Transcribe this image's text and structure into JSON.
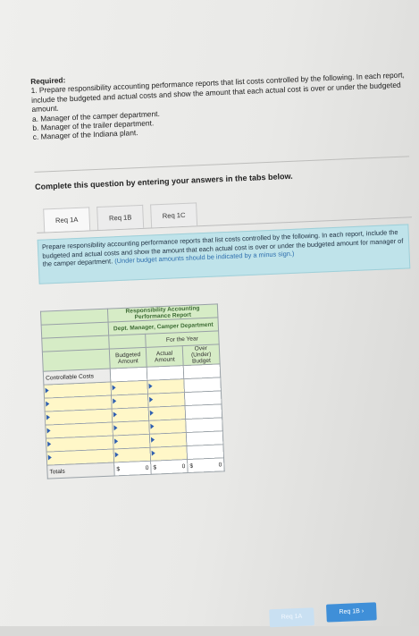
{
  "requirements": {
    "title": "Required:",
    "line1": "1. Prepare responsibility accounting performance reports that list costs controlled by the following. In each report, include the budgeted and actual costs and show the amount that each actual cost is over or under the budgeted amount.",
    "item_a": "a. Manager of the camper department.",
    "item_b": "b. Manager of the trailer department.",
    "item_c": "c. Manager of the Indiana plant."
  },
  "complete_prompt": "Complete this question by entering your answers in the tabs below.",
  "tabs": [
    {
      "label": "Req 1A",
      "active": true
    },
    {
      "label": "Req 1B",
      "active": false
    },
    {
      "label": "Req 1C",
      "active": false
    }
  ],
  "instructions": {
    "main": "Prepare responsibility accounting performance reports that list costs controlled by the following. In each report, include the budgeted and actual costs and show the amount that each actual cost is over or under the budgeted amount for manager of the camper department.",
    "note": "(Under budget amounts should be indicated by a minus sign.)"
  },
  "report": {
    "title": "Responsibility Accounting Performance Report",
    "subtitle": "Dept. Manager, Camper Department",
    "period": "For the Year",
    "col_budget": "Budgeted Amount",
    "col_actual": "Actual Amount",
    "col_over": "Over (Under) Budget",
    "row_controllable": "Controllable Costs",
    "row_totals": "Totals",
    "totals": {
      "budget": "0",
      "actual": "0",
      "over": "0",
      "currency": "$"
    }
  },
  "nav": {
    "prev": "Req 1A",
    "next": "Req 1B",
    "next_glyph": "›"
  },
  "colors": {
    "accent": "#3f8fd8",
    "instructions_bg": "#bfe3ea",
    "table_header_bg": "#d6ecc6"
  }
}
